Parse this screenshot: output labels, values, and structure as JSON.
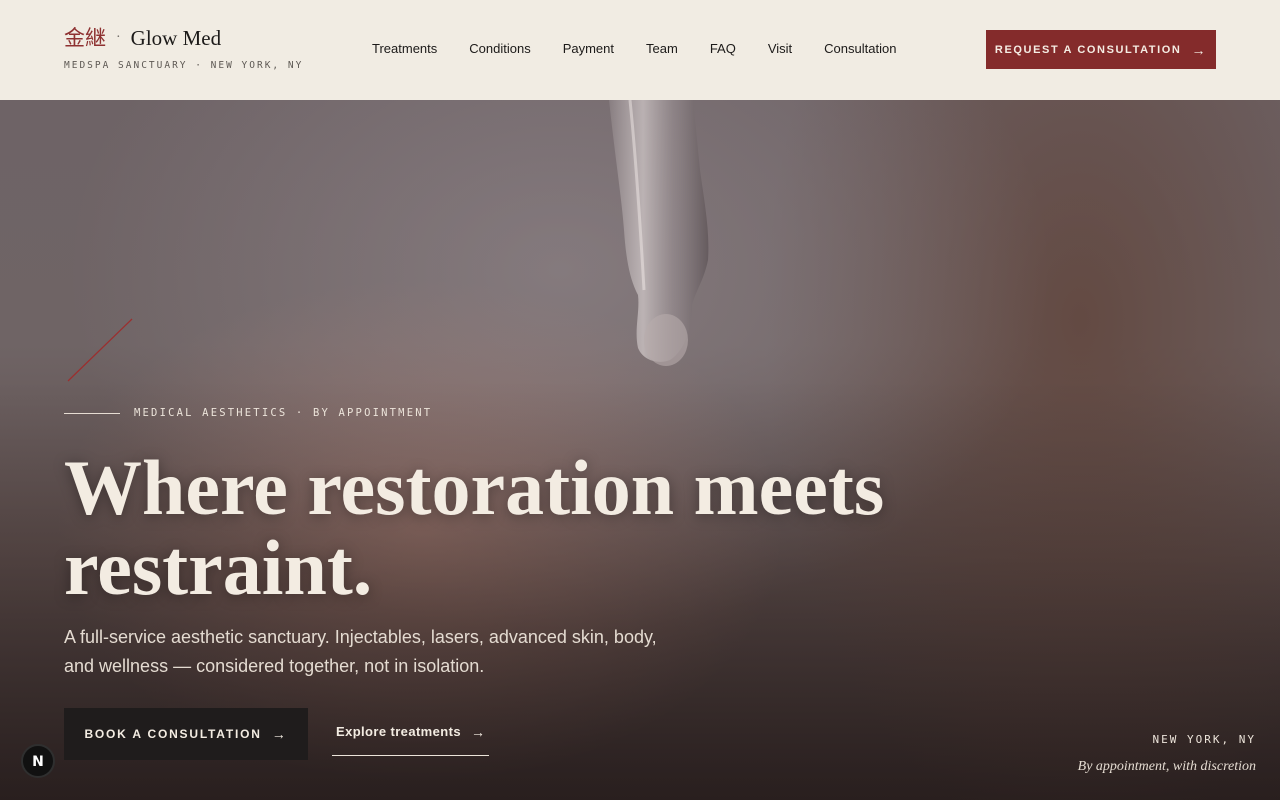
{
  "brand": {
    "kanji": "金継",
    "separator": "·",
    "name": "Glow Med",
    "tagline": "MEDSPA SANCTUARY · NEW YORK, NY"
  },
  "nav": {
    "items": [
      "Treatments",
      "Conditions",
      "Payment",
      "Team",
      "FAQ",
      "Visit",
      "Consultation"
    ]
  },
  "header_cta": {
    "label": "REQUEST A CONSULTATION",
    "arrow": "→"
  },
  "hero": {
    "eyebrow": "MEDICAL AESTHETICS · BY APPOINTMENT",
    "headline": "Where restoration meets restraint.",
    "lede": "A full-service aesthetic sanctuary. Injectables, lasers, advanced skin, body, and wellness — considered together, not in isolation.",
    "primary_button": {
      "label": "BOOK A CONSULTATION",
      "arrow": "→"
    },
    "secondary_button": {
      "label": "Explore treatments",
      "arrow": "→"
    },
    "location": {
      "city": "NEW YORK, NY",
      "note": "By appointment, with discretion"
    }
  },
  "dev_badge": {
    "letter": "N"
  },
  "colors": {
    "accent": "#842b2b",
    "background": "#f1ece3",
    "dark_button": "#1f1c1c",
    "headline": "#f3ece2"
  },
  "icons": [
    "arrow-right-icon",
    "dropper-image",
    "red-slash-decoration",
    "nextjs-icon"
  ]
}
